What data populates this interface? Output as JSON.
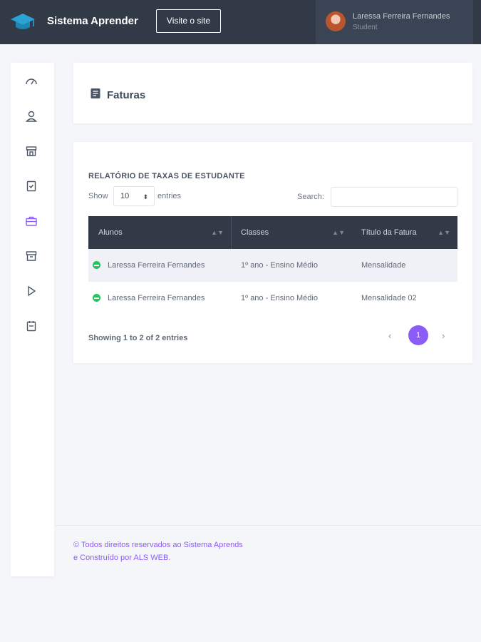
{
  "header": {
    "brand": "Sistema Aprender",
    "visit_button": "Visite o site",
    "user_name": "Laressa Ferreira Fernandes",
    "user_role": "Student"
  },
  "sidebar": {
    "icons": [
      "dashboard-icon",
      "user-icon",
      "store-icon",
      "clipboard-icon",
      "briefcase-icon",
      "inbox-icon",
      "play-icon",
      "calendar-icon"
    ],
    "active_index": 4,
    "active_color": "#8b5cf6"
  },
  "page": {
    "title": "Faturas"
  },
  "report": {
    "title": "RELATÓRIO DE TAXAS DE ESTUDANTE",
    "show_label": "Show",
    "show_value": "10",
    "entries_label": "entries",
    "search_label": "Search:",
    "search_value": "",
    "columns": [
      "Alunos",
      "Classes",
      "Título da Fatura"
    ],
    "rows": [
      {
        "aluno": "Laressa Ferreira Fernandes",
        "classe": "1º ano - Ensino Médio",
        "fatura": "Mensalidade"
      },
      {
        "aluno": "Laressa Ferreira Fernandes",
        "classe": "1º ano - Ensino Médio",
        "fatura": "Mensalidade 02"
      }
    ],
    "info": "Showing 1 to 2 of 2 entries",
    "pagination": {
      "prev": "‹",
      "current": "1",
      "next": "›"
    }
  },
  "footer": {
    "text": "© Todos direitos reservados ao Sistema Aprends e Construído por ALS WEB."
  },
  "colors": {
    "topbar": "#323a48",
    "accent": "#8b5cf6",
    "status_green": "#22c55e",
    "logo": "#2aa3d4"
  }
}
